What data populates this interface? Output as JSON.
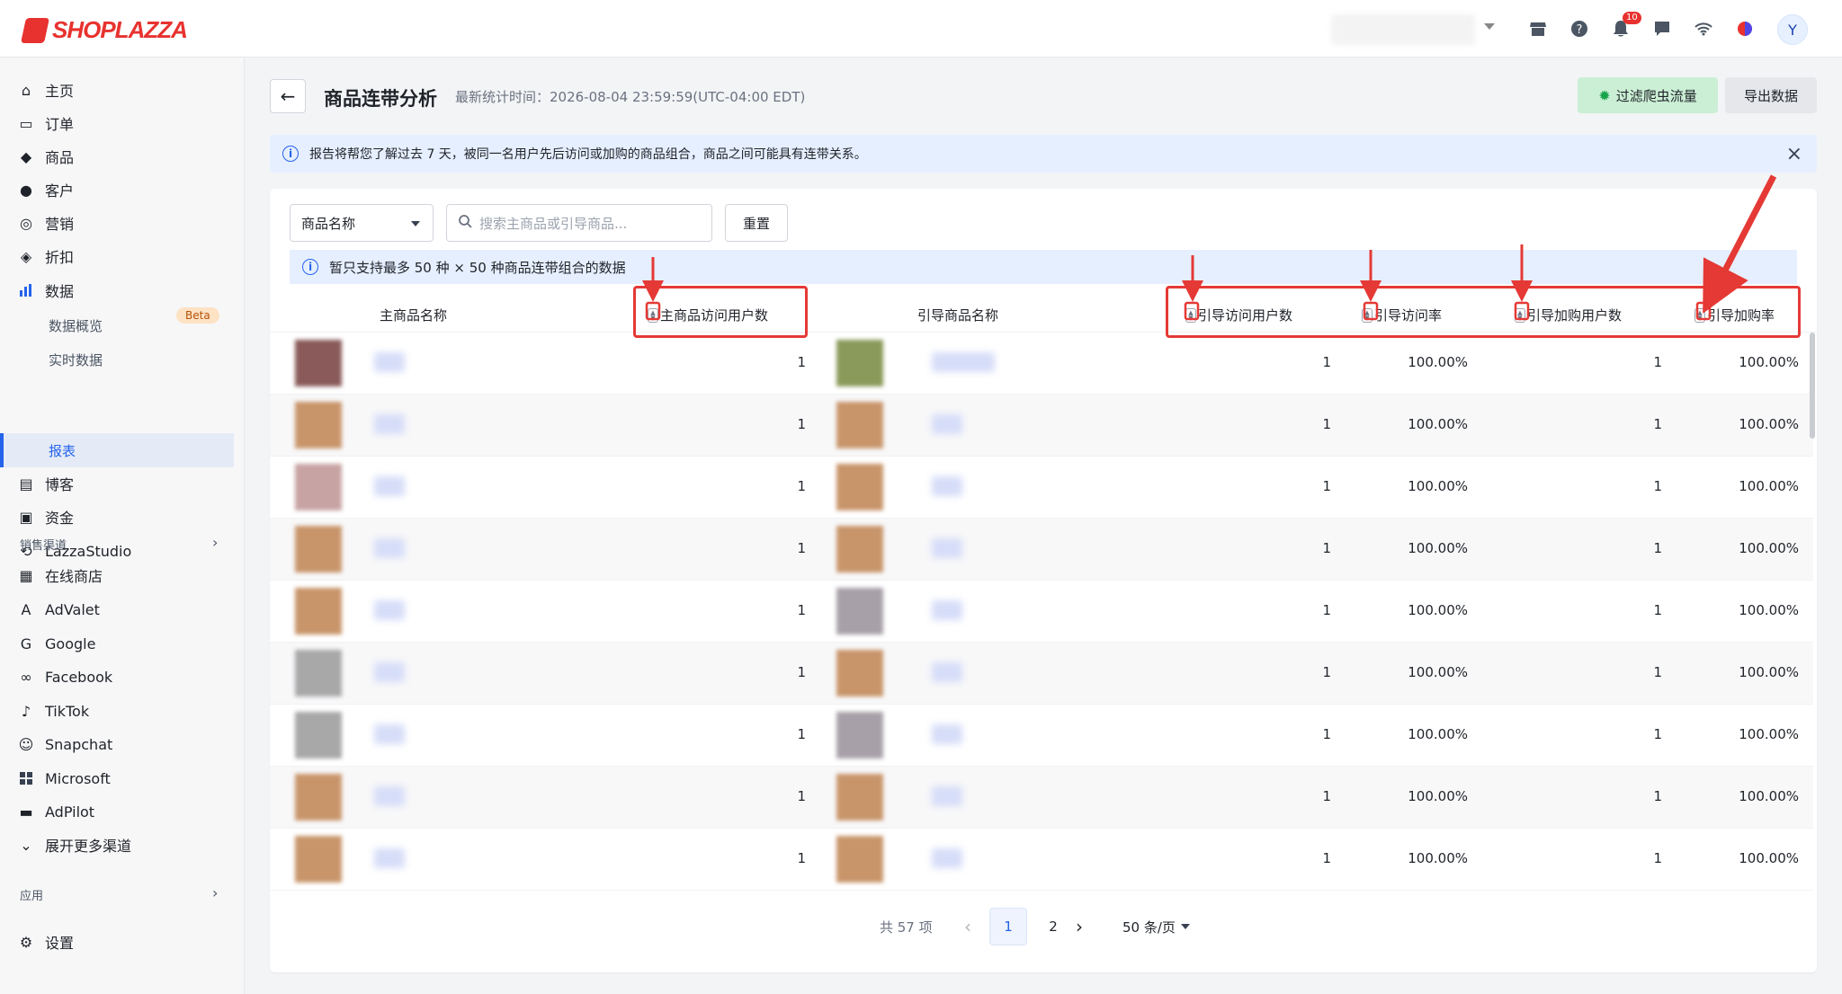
{
  "brand": {
    "name": "SHOPLAZZA",
    "color": "#e8322f"
  },
  "topbar": {
    "icons": [
      "store-icon",
      "help-icon",
      "bell-icon",
      "chat-icon",
      "wifi-icon",
      "app-icon"
    ],
    "notification_count": "10",
    "avatar_letter": "Y"
  },
  "sidebar": {
    "items": [
      {
        "label": "主页",
        "icon": "home-icon"
      },
      {
        "label": "订单",
        "icon": "order-icon"
      },
      {
        "label": "商品",
        "icon": "tag-icon"
      },
      {
        "label": "客户",
        "icon": "user-icon"
      },
      {
        "label": "营销",
        "icon": "marketing-icon"
      },
      {
        "label": "折扣",
        "icon": "discount-icon"
      },
      {
        "label": "数据",
        "icon": "chart-icon"
      }
    ],
    "beta": "Beta",
    "data_sub": [
      {
        "label": "数据概览"
      },
      {
        "label": "实时数据"
      },
      {
        "label": "报表"
      }
    ],
    "items2": [
      {
        "label": "博客",
        "icon": "blog-icon"
      },
      {
        "label": "资金",
        "icon": "wallet-icon"
      },
      {
        "label": "LazzaStudio",
        "icon": "studio-icon"
      }
    ],
    "channels_title": "销售渠道",
    "channels": [
      {
        "label": "在线商店",
        "icon": "store-icon"
      },
      {
        "label": "AdValet",
        "icon": "advalet-icon"
      },
      {
        "label": "Google",
        "icon": "google-icon"
      },
      {
        "label": "Facebook",
        "icon": "meta-icon"
      },
      {
        "label": "TikTok",
        "icon": "tiktok-icon"
      },
      {
        "label": "Snapchat",
        "icon": "snapchat-icon"
      },
      {
        "label": "Microsoft",
        "icon": "microsoft-icon"
      },
      {
        "label": "AdPilot",
        "icon": "adpilot-icon"
      }
    ],
    "more_channels": "展开更多渠道",
    "apps_title": "应用",
    "settings": "设置"
  },
  "header": {
    "title": "商品连带分析",
    "stat_time": "最新统计时间：2026-08-04 23:59:59(UTC-04:00 EDT)",
    "filter_btn": "过滤爬虫流量",
    "export_btn": "导出数据"
  },
  "banner": {
    "text": "报告将帮您了解过去 7 天，被同一名用户先后访问或加购的商品组合，商品之间可能具有连带关系。"
  },
  "filters": {
    "select_value": "商品名称",
    "search_placeholder": "搜索主商品或引导商品...",
    "reset": "重置"
  },
  "note": "暂只支持最多 50 种 × 50 种商品连带组合的数据",
  "table": {
    "columns": [
      "主商品名称",
      "主商品访问用户数",
      "引导商品名称",
      "引导访问用户数",
      "引导访问率",
      "引导加购用户数",
      "引导加购率"
    ],
    "rows": [
      {
        "main_visitors": "1",
        "guide_visitors": "1",
        "guide_visit_rate": "100.00%",
        "guide_cart_users": "1",
        "guide_cart_rate": "100.00%"
      },
      {
        "main_visitors": "1",
        "guide_visitors": "1",
        "guide_visit_rate": "100.00%",
        "guide_cart_users": "1",
        "guide_cart_rate": "100.00%"
      },
      {
        "main_visitors": "1",
        "guide_visitors": "1",
        "guide_visit_rate": "100.00%",
        "guide_cart_users": "1",
        "guide_cart_rate": "100.00%"
      },
      {
        "main_visitors": "1",
        "guide_visitors": "1",
        "guide_visit_rate": "100.00%",
        "guide_cart_users": "1",
        "guide_cart_rate": "100.00%"
      },
      {
        "main_visitors": "1",
        "guide_visitors": "1",
        "guide_visit_rate": "100.00%",
        "guide_cart_users": "1",
        "guide_cart_rate": "100.00%"
      },
      {
        "main_visitors": "1",
        "guide_visitors": "1",
        "guide_visit_rate": "100.00%",
        "guide_cart_users": "1",
        "guide_cart_rate": "100.00%"
      },
      {
        "main_visitors": "1",
        "guide_visitors": "1",
        "guide_visit_rate": "100.00%",
        "guide_cart_users": "1",
        "guide_cart_rate": "100.00%"
      },
      {
        "main_visitors": "1",
        "guide_visitors": "1",
        "guide_visit_rate": "100.00%",
        "guide_cart_users": "1",
        "guide_cart_rate": "100.00%"
      },
      {
        "main_visitors": "1",
        "guide_visitors": "1",
        "guide_visit_rate": "100.00%",
        "guide_cart_users": "1",
        "guide_cart_rate": "100.00%"
      }
    ]
  },
  "pagination": {
    "total": "共 57 项",
    "pages": [
      "1",
      "2"
    ],
    "current": "1",
    "page_size": "50 条/页"
  },
  "colors": {
    "accent": "#2563eb",
    "annotation": "#e53935",
    "filter_bg": "#cbefd5"
  }
}
